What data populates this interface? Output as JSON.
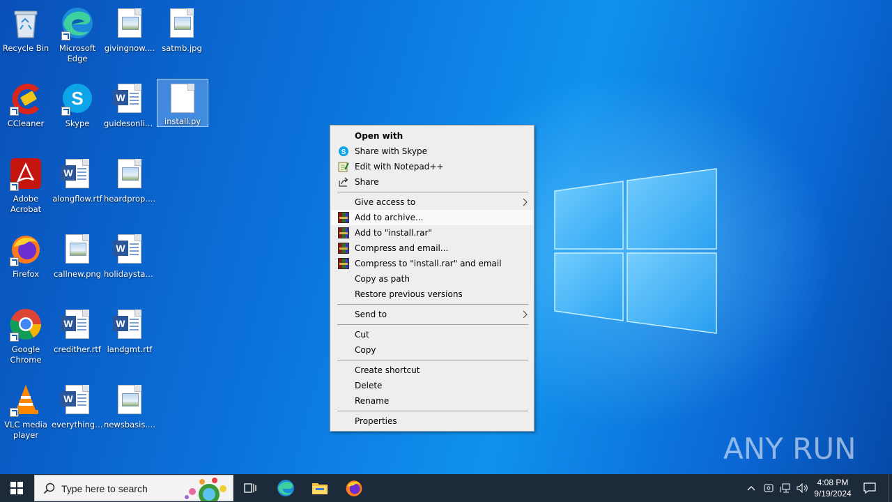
{
  "desktop": {
    "icons": [
      {
        "label": "Recycle Bin",
        "icon": "recycle-bin-icon"
      },
      {
        "label": "Microsoft Edge",
        "icon": "edge-icon"
      },
      {
        "label": "givingnow....",
        "icon": "image-file-icon"
      },
      {
        "label": "satmb.jpg",
        "icon": "image-file-icon"
      },
      {
        "label": "CCleaner",
        "icon": "ccleaner-icon"
      },
      {
        "label": "Skype",
        "icon": "skype-icon"
      },
      {
        "label": "guidesonlin...",
        "icon": "word-file-icon"
      },
      {
        "label": "install.py",
        "icon": "blank-file-icon",
        "selected": true
      },
      {
        "label": "Adobe Acrobat",
        "icon": "acrobat-icon"
      },
      {
        "label": "alongflow.rtf",
        "icon": "word-file-icon"
      },
      {
        "label": "heardprop....",
        "icon": "image-file-icon"
      },
      {
        "label": "Firefox",
        "icon": "firefox-icon"
      },
      {
        "label": "callnew.png",
        "icon": "image-file-icon"
      },
      {
        "label": "holidaystax....",
        "icon": "word-file-icon"
      },
      {
        "label": "Google Chrome",
        "icon": "chrome-icon"
      },
      {
        "label": "credither.rtf",
        "icon": "word-file-icon"
      },
      {
        "label": "landgmt.rtf",
        "icon": "word-file-icon"
      },
      {
        "label": "VLC media player",
        "icon": "vlc-icon"
      },
      {
        "label": "everything....",
        "icon": "word-file-icon"
      },
      {
        "label": "newsbasis....",
        "icon": "image-file-icon"
      }
    ],
    "watermark": "ANY RUN"
  },
  "context_menu": {
    "open_with": "Open with",
    "share_skype": "Share with Skype",
    "edit_notepad": "Edit with Notepad++",
    "share": "Share",
    "give_access": "Give access to",
    "add_archive": "Add to archive...",
    "add_rar": "Add to \"install.rar\"",
    "compress_email": "Compress and email...",
    "compress_rar_email": "Compress to \"install.rar\" and email",
    "copy_path": "Copy as path",
    "restore": "Restore previous versions",
    "send_to": "Send to",
    "cut": "Cut",
    "copy": "Copy",
    "create_shortcut": "Create shortcut",
    "delete": "Delete",
    "rename": "Rename",
    "properties": "Properties"
  },
  "taskbar": {
    "search_placeholder": "Type here to search",
    "time": "4:08 PM",
    "date": "9/19/2024"
  },
  "colors": {
    "taskbar": "#1c2a3a",
    "menu_bg": "#eeeeee",
    "accent": "#0b74dc"
  }
}
